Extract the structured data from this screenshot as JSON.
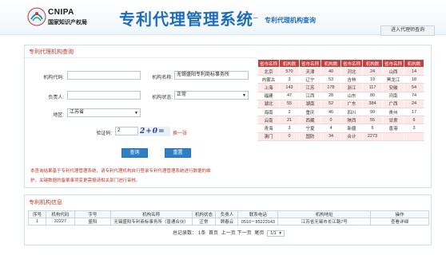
{
  "header": {
    "logo_text": "CNIPA",
    "logo_sub": "国家知识产权局",
    "title": "专利代理管理系统",
    "dash": "–",
    "subtitle": "专利代理机构查询",
    "enter_button": "进入代理师查询"
  },
  "query": {
    "panel_title": "专利代理机构查询",
    "org_code_label": "机构代码:",
    "org_code_value": "",
    "org_name_label": "机构名称:",
    "org_name_value": "无锡盛阳专利商标事务所",
    "owner_label": "负责人:",
    "owner_value": "",
    "status_label": "机构状态:",
    "status_value": "正常",
    "region_label": "地区:",
    "region_value": "江苏省",
    "captcha_label": "验证码:",
    "captcha_value": "2",
    "captcha_image_text": "2+0=",
    "captcha_change": "换一张",
    "search_button": "查询",
    "reset_button": "重置",
    "notice_line1": "本查询结果基于专利代理管理系统，请专利代理机构自行登录专利代理管理系统进行数据的维",
    "notice_line2": "护，关键数据的备案事项变更需报请相关部门进行审核。"
  },
  "regions": {
    "headers": [
      "省市名称",
      "机构数",
      "省市名称",
      "机构数",
      "省市名称",
      "机构数",
      "省市名称",
      "机构数"
    ],
    "rows": [
      [
        "北京",
        "570",
        "天津",
        "40",
        "河北",
        "24",
        "山西",
        "14"
      ],
      [
        "内蒙古",
        "3",
        "辽宁",
        "53",
        "吉林",
        "19",
        "黑龙江",
        "18"
      ],
      [
        "上海",
        "143",
        "江苏",
        "178",
        "浙江",
        "117",
        "安徽",
        "54"
      ],
      [
        "福建",
        "47",
        "江西",
        "28",
        "山东",
        "80",
        "河南",
        "74"
      ],
      [
        "湖北",
        "55",
        "湖南",
        "52",
        "广东",
        "384",
        "广西",
        "24"
      ],
      [
        "海南",
        "2",
        "重庆",
        "46",
        "四川",
        "99",
        "贵州",
        "17"
      ],
      [
        "云南",
        "21",
        "西藏",
        "0",
        "陕西",
        "55",
        "甘肃",
        "6"
      ],
      [
        "青海",
        "3",
        "宁夏",
        "4",
        "新疆",
        "6",
        "香港",
        "3"
      ],
      [
        "澳门",
        "0",
        "国防",
        "34",
        "合计",
        "2273",
        "",
        ""
      ]
    ]
  },
  "info": {
    "panel_title": "专利机构信息",
    "headers": [
      "序号",
      "机构代码",
      "字号",
      "机构名称",
      "机构状态",
      "负责人",
      "联系电话",
      "机构地址",
      "操作"
    ],
    "rows": [
      [
        "1",
        "32227",
        "盛阳",
        "无锡盛阳专利商标事务所（普通合伙）",
        "正常",
        "顾春云",
        "0510－85223143",
        "江苏省无锡市长江路7号",
        "查看详细"
      ]
    ],
    "pager": {
      "total_label": "总记录数：",
      "total": "1条",
      "first": "首页",
      "prev": "上一页",
      "next": "下一页",
      "last": "尾页",
      "page_select": "1/1"
    }
  }
}
